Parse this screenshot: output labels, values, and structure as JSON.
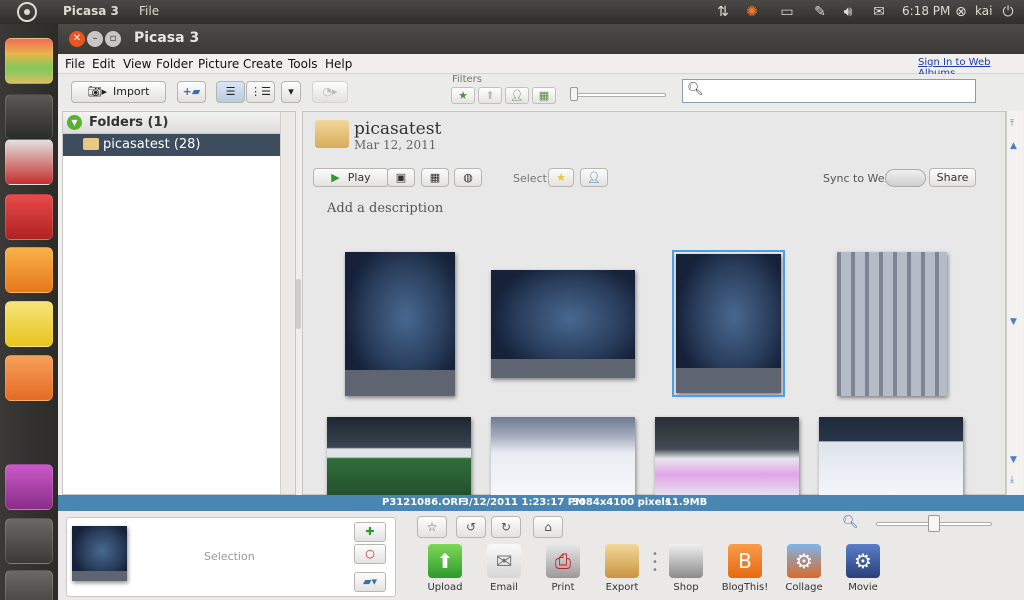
{
  "top_panel": {
    "app_name": "Picasa 3",
    "menu_file": "File",
    "clock": "6:18 PM",
    "user": "kai",
    "indicators": [
      "transfer-icon",
      "sun-icon",
      "battery-icon",
      "note-icon",
      "volume-icon",
      "mail-icon",
      "power-icon"
    ]
  },
  "launcher": {
    "items": [
      "files-stack-icon",
      "terminal-icon",
      "red-book-icon",
      "installer-icon",
      "starburst-icon",
      "notepad-icon",
      "folder-app-icon",
      "pink-window-icon",
      "file-manager-icon",
      "scissors-icon"
    ]
  },
  "window": {
    "title": "Picasa 3",
    "menu": [
      "File",
      "Edit",
      "View",
      "Folder",
      "Picture",
      "Create",
      "Tools",
      "Help"
    ],
    "signin": "Sign In to Web Albums"
  },
  "toolbar": {
    "import_label": "Import",
    "filters_label": "Filters",
    "search_placeholder": ""
  },
  "folders": {
    "header": "Folders (1)",
    "items": [
      {
        "label": "picasatest (28)"
      }
    ]
  },
  "album": {
    "name": "picasatest",
    "date": "Mar 12, 2011",
    "play_label": "Play",
    "select_label": "Select",
    "sync_label": "Sync to Web",
    "share_label": "Share",
    "description_placeholder": "Add a description"
  },
  "status": {
    "filename": "P3121086.ORF",
    "datetime": "3/12/2011 1:23:17 PM",
    "dimensions": "3084x4100 pixels",
    "size": "11.9MB"
  },
  "tray": {
    "selection_label": "Selection"
  },
  "actions": [
    {
      "label": "Upload"
    },
    {
      "label": "Email"
    },
    {
      "label": "Print"
    },
    {
      "label": "Export"
    },
    {
      "label": "Shop"
    },
    {
      "label": "BlogThis!"
    },
    {
      "label": "Collage"
    },
    {
      "label": "Movie"
    }
  ],
  "colors": {
    "selection_blue": "#4aa0e8",
    "status_bar": "#4a86b4",
    "folder_highlight": "#3d4d5e",
    "ubuntu_orange": "#e95420"
  }
}
